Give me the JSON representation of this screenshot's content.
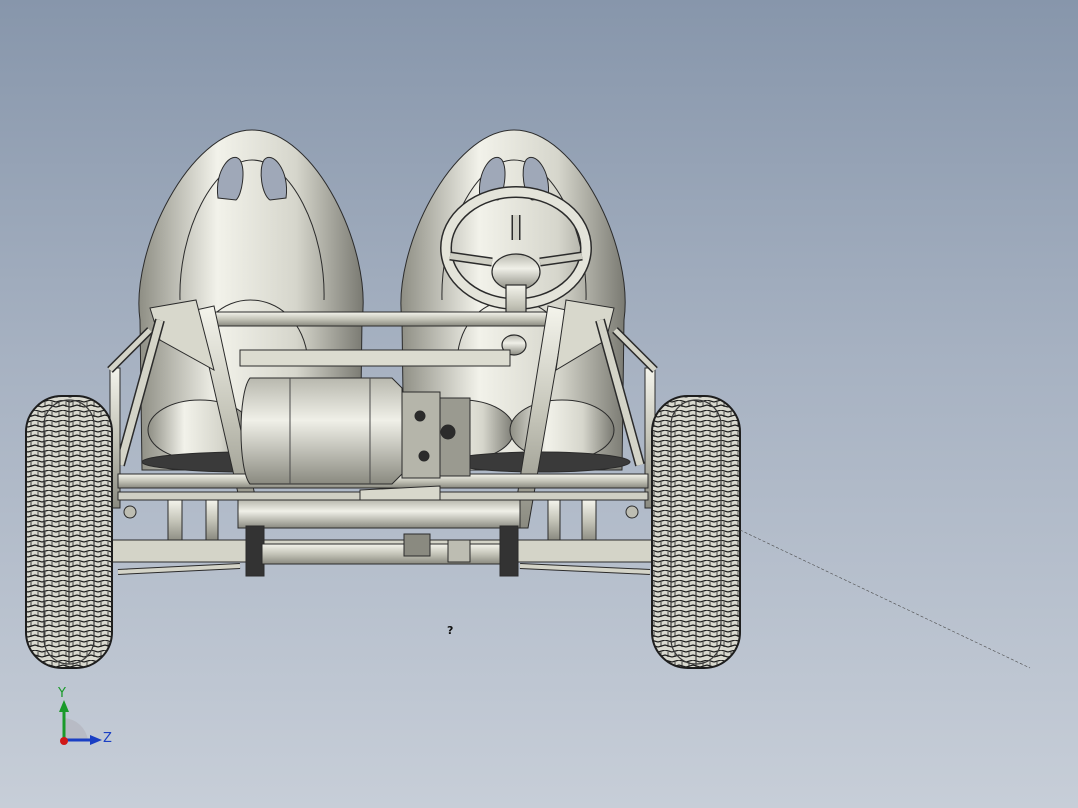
{
  "viewport": {
    "background_top": "#8796ab",
    "background_bottom": "#c7ced8",
    "model_line_color": "#2b2b2b",
    "model_fill": "#dcdcd0"
  },
  "triad": {
    "y_label": "Y",
    "z_label": "Z",
    "y_color": "#1a9a2a",
    "z_color": "#1a3fc4",
    "x_color": "#d01818"
  },
  "cursor_marker": {
    "icon": "question-cursor-icon",
    "symbol": "?"
  }
}
